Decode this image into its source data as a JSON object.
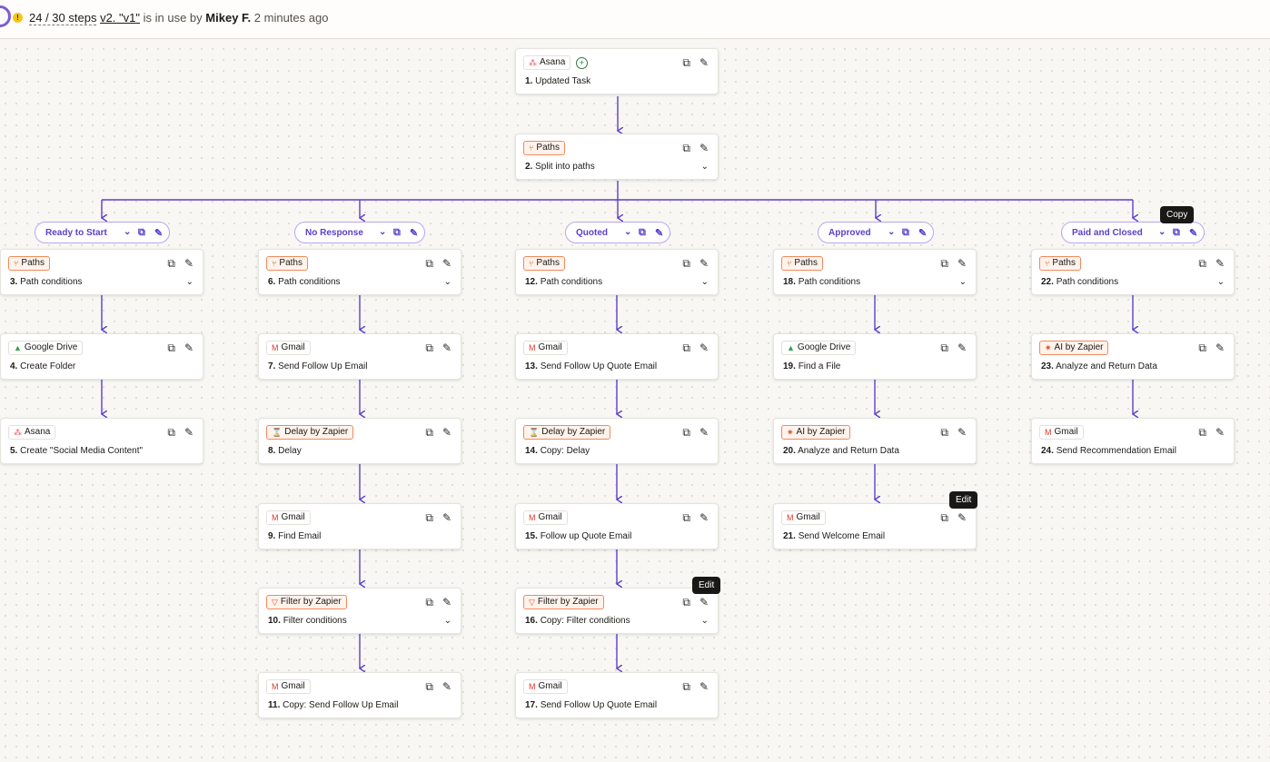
{
  "header": {
    "steps": "24 / 30 steps",
    "version": "v2. \"v1\"",
    "in_use_text": "is in use by",
    "user": "Mikey F.",
    "time_ago": "2 minutes ago"
  },
  "colors": {
    "accent": "#6b4fd1",
    "path_orange": "#f08a5d",
    "connector": "#5a3fc9"
  },
  "trigger": {
    "app": "Asana",
    "number": "1.",
    "title": "Updated Task",
    "icon": "asana-icon"
  },
  "split": {
    "app": "Paths",
    "number": "2.",
    "title": "Split into paths",
    "icon": "paths-icon"
  },
  "paths": [
    {
      "label": "Ready to Start",
      "steps": [
        {
          "app": "Paths",
          "number": "3.",
          "title": "Path conditions",
          "icon": "paths-icon"
        },
        {
          "app": "Google Drive",
          "number": "4.",
          "title": "Create Folder",
          "icon": "google-drive-icon"
        },
        {
          "app": "Asana",
          "number": "5.",
          "title": "Create \"Social Media Content\"",
          "icon": "asana-icon"
        }
      ]
    },
    {
      "label": "No Response",
      "steps": [
        {
          "app": "Paths",
          "number": "6.",
          "title": "Path conditions",
          "icon": "paths-icon"
        },
        {
          "app": "Gmail",
          "number": "7.",
          "title": "Send Follow Up Email",
          "icon": "gmail-icon"
        },
        {
          "app": "Delay by Zapier",
          "number": "8.",
          "title": "Delay",
          "icon": "delay-icon"
        },
        {
          "app": "Gmail",
          "number": "9.",
          "title": "Find Email",
          "icon": "gmail-icon"
        },
        {
          "app": "Filter by Zapier",
          "number": "10.",
          "title": "Filter conditions",
          "icon": "filter-icon"
        },
        {
          "app": "Gmail",
          "number": "11.",
          "title": "Copy: Send Follow Up Email",
          "icon": "gmail-icon"
        }
      ]
    },
    {
      "label": "Quoted",
      "steps": [
        {
          "app": "Paths",
          "number": "12.",
          "title": "Path conditions",
          "icon": "paths-icon"
        },
        {
          "app": "Gmail",
          "number": "13.",
          "title": "Send Follow Up Quote Email",
          "icon": "gmail-icon"
        },
        {
          "app": "Delay by Zapier",
          "number": "14.",
          "title": "Copy: Delay",
          "icon": "delay-icon"
        },
        {
          "app": "Gmail",
          "number": "15.",
          "title": "Follow up Quote Email",
          "icon": "gmail-icon"
        },
        {
          "app": "Filter by Zapier",
          "number": "16.",
          "title": "Copy: Filter conditions",
          "icon": "filter-icon"
        },
        {
          "app": "Gmail",
          "number": "17.",
          "title": "Send Follow Up Quote Email",
          "icon": "gmail-icon"
        }
      ]
    },
    {
      "label": "Approved",
      "steps": [
        {
          "app": "Paths",
          "number": "18.",
          "title": "Path conditions",
          "icon": "paths-icon"
        },
        {
          "app": "Google Drive",
          "number": "19.",
          "title": "Find a File",
          "icon": "google-drive-icon"
        },
        {
          "app": "AI by Zapier",
          "number": "20.",
          "title": "Analyze and Return Data",
          "icon": "ai-icon"
        },
        {
          "app": "Gmail",
          "number": "21.",
          "title": "Send Welcome Email",
          "icon": "gmail-icon"
        }
      ]
    },
    {
      "label": "Paid and Closed",
      "steps": [
        {
          "app": "Paths",
          "number": "22.",
          "title": "Path conditions",
          "icon": "paths-icon"
        },
        {
          "app": "AI by Zapier",
          "number": "23.",
          "title": "Analyze and Return Data",
          "icon": "ai-icon"
        },
        {
          "app": "Gmail",
          "number": "24.",
          "title": "Send Recommendation Email",
          "icon": "gmail-icon"
        }
      ]
    }
  ],
  "tooltips": {
    "copy": "Copy",
    "edit": "Edit"
  }
}
